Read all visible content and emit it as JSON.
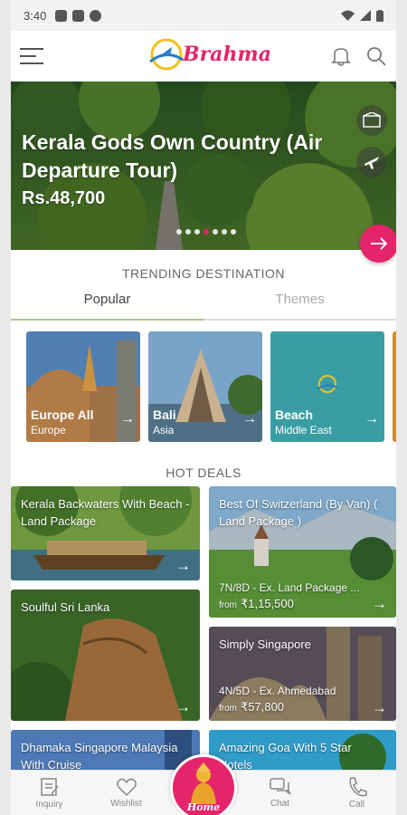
{
  "status_bar": {
    "time": "3:40"
  },
  "header": {
    "logo_text": "Brahma"
  },
  "hero": {
    "title": "Kerala Gods Own Country (Air Departure Tour)",
    "price": "Rs.48,700",
    "slides_total": 7,
    "active_slide": 3
  },
  "trending": {
    "title": "TRENDING DESTINATION",
    "tabs": [
      {
        "label": "Popular",
        "active": true
      },
      {
        "label": "Themes",
        "active": false
      }
    ],
    "destinations": [
      {
        "name": "Europe All",
        "region": "Europe"
      },
      {
        "name": "Bali",
        "region": "Asia"
      },
      {
        "name": "Beach",
        "region": "Middle East"
      }
    ]
  },
  "hot_deals": {
    "title": "HOT DEALS",
    "deals": [
      {
        "title": "Kerala Backwaters With Beach - Land Package",
        "subtitle": "",
        "price": ""
      },
      {
        "title": "Best Of Switzerland (By Van) ( Land Package )",
        "subtitle": "7N/8D - Ex. Land Package ...",
        "price_prefix": "from",
        "price": "₹1,15,500"
      },
      {
        "title": "Soulful Sri Lanka",
        "subtitle": "",
        "price": ""
      },
      {
        "title": "Simply Singapore",
        "subtitle": "4N/5D - Ex. Ahmedabad",
        "price_prefix": "from",
        "price": "₹57,800"
      },
      {
        "title": "Dhamaka Singapore Malaysia With Cruise",
        "subtitle": "",
        "price": ""
      },
      {
        "title": "Amazing Goa With 5 Star Hotels",
        "subtitle": "",
        "price": ""
      }
    ]
  },
  "bottom_nav": {
    "items": [
      {
        "label": "Inquiry",
        "icon": "inquiry-icon"
      },
      {
        "label": "Wishlist",
        "icon": "heart-icon"
      },
      {
        "label": "Home",
        "icon": "home-icon"
      },
      {
        "label": "Chat",
        "icon": "chat-icon"
      },
      {
        "label": "Call",
        "icon": "phone-icon"
      }
    ]
  },
  "colors": {
    "accent": "#e6246a",
    "beach_teal": "#3a9da4",
    "tab_indicator": "#a8c48e"
  }
}
